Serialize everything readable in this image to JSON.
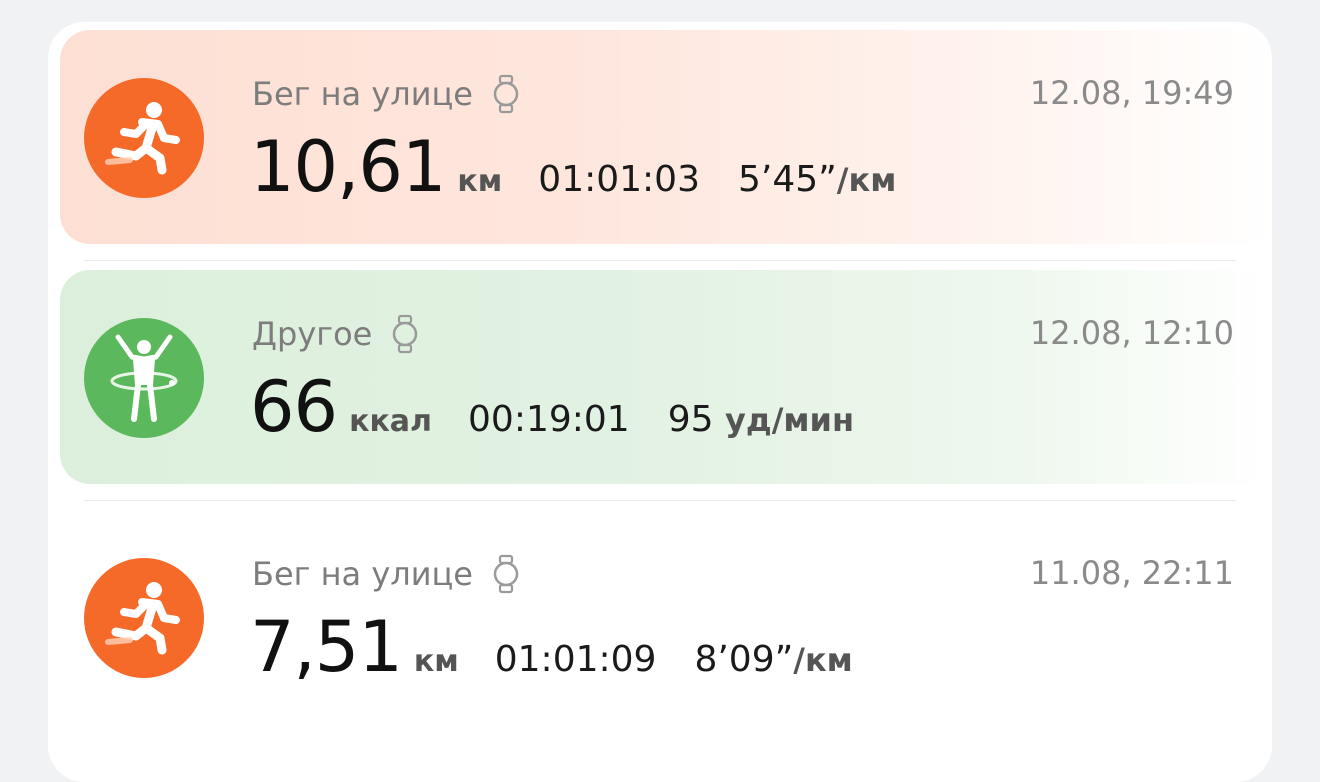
{
  "workouts": [
    {
      "type": "Бег на улице",
      "icon": "running-person-icon",
      "color": "#f56a28",
      "datetime": "12.08, 19:49",
      "main_value": "10,61",
      "main_unit": "км",
      "duration": "01:01:03",
      "secondary_value": "5’45”",
      "secondary_unit": "/км"
    },
    {
      "type": "Другое",
      "icon": "hula-hoop-person-icon",
      "color": "#5cb85c",
      "datetime": "12.08, 12:10",
      "main_value": "66",
      "main_unit": "ккал",
      "duration": "00:19:01",
      "secondary_value": "95 ",
      "secondary_unit": "уд/мин"
    },
    {
      "type": "Бег на улице",
      "icon": "running-person-icon",
      "color": "#f56a28",
      "datetime": "11.08, 22:11",
      "main_value": "7,51",
      "main_unit": "км",
      "duration": "01:01:09",
      "secondary_value": "8’09”",
      "secondary_unit": "/км"
    }
  ]
}
